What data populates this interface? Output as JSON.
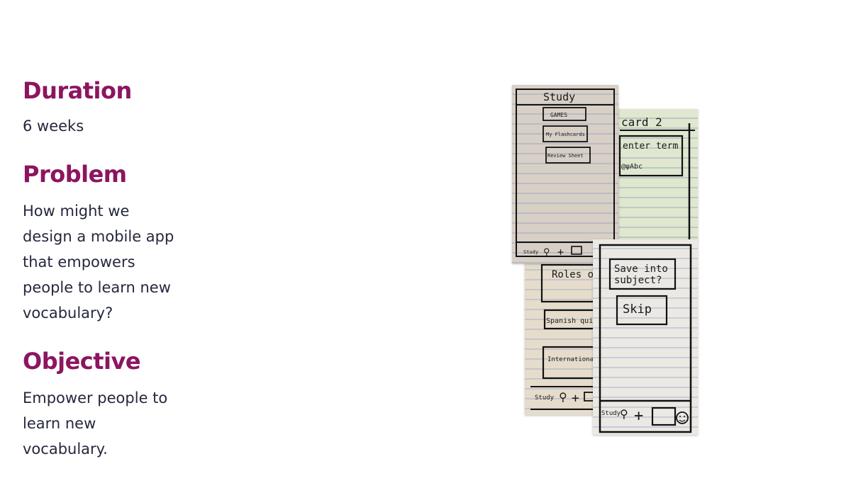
{
  "duration": {
    "heading": "Duration",
    "body": "6 weeks"
  },
  "problem": {
    "heading": "Problem",
    "lines": [
      "How might we",
      "design a mobile app",
      "that empowers",
      "people to learn new",
      "vocabulary?"
    ]
  },
  "objective": {
    "heading": "Objective",
    "lines": [
      "Empower people to",
      "learn new",
      "vocabulary."
    ]
  },
  "sketches": {
    "study_screen": {
      "title": "Study",
      "buttons": [
        "GAMES",
        "My Flashcards",
        "Review Sheet"
      ],
      "nav_label": "Study"
    },
    "card_screen": {
      "title": "card 2",
      "field": "enter term",
      "keyboard_hint": "@ψAbc"
    },
    "subjects_screen": {
      "items": [
        "Roles of operations Management",
        "Spanish quiz",
        "International Business"
      ],
      "nav_label": "Study"
    },
    "save_screen": {
      "prompt_line1": "Save into",
      "prompt_line2": "subject?",
      "skip": "Skip",
      "nav_label": "Study"
    }
  }
}
